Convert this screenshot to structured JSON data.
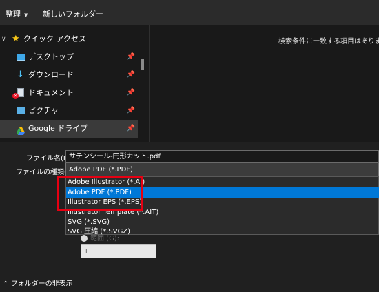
{
  "toolbar": {
    "organize_label": "整理",
    "new_folder_label": "新しいフォルダー"
  },
  "nav": {
    "quick_access": "クイック アクセス",
    "items": [
      {
        "label": "デスクトップ",
        "icon": "desktop-icon"
      },
      {
        "label": "ダウンロード",
        "icon": "download-icon"
      },
      {
        "label": "ドキュメント",
        "icon": "document-icon"
      },
      {
        "label": "ピクチャ",
        "icon": "pictures-icon"
      },
      {
        "label": "Google ドライブ",
        "icon": "google-drive-icon"
      }
    ]
  },
  "content": {
    "empty_message": "検索条件に一致する項目はありませ"
  },
  "form": {
    "filename_label": "ファイル名(N):",
    "filename_value": "サテンシール-円形カット.pdf",
    "filetype_label": "ファイルの種類(T):",
    "filetype_value": "Adobe PDF (*.PDF)",
    "filetype_options": [
      "Adobe Illustrator (*.AI)",
      "Adobe PDF (*.PDF)",
      "Illustrator EPS (*.EPS)",
      "Illustrator Template (*.AIT)",
      "SVG (*.SVG)",
      "SVG 圧縮 (*.SVGZ)"
    ],
    "highlighted_option": "Adobe PDF (*.PDF)",
    "range_label": "範囲 (G):",
    "range_value": "1"
  },
  "footer": {
    "hide_folders": "フォルダーの非表示"
  },
  "colors": {
    "highlight": "#0078d7",
    "annotation_red": "#e60012"
  }
}
